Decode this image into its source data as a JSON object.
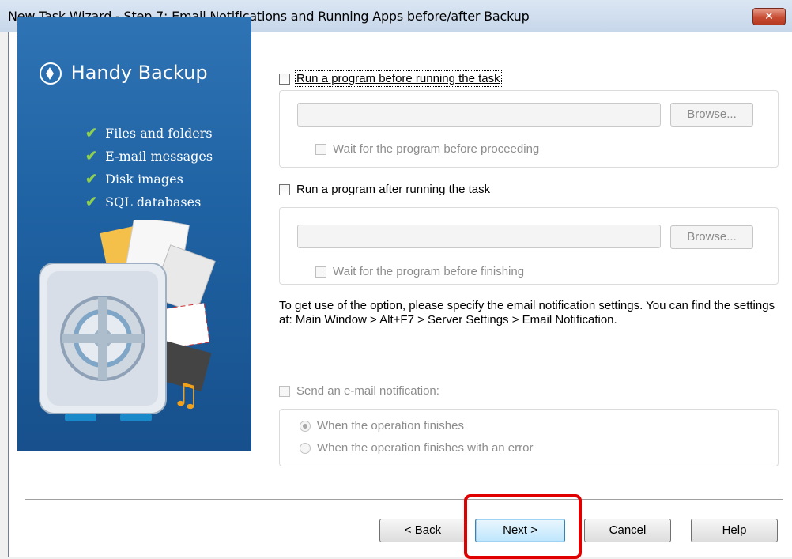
{
  "window": {
    "title": "New Task Wizard - Step 7: Email Notifications and Running Apps before/after Backup",
    "close_label": "✕"
  },
  "banner": {
    "logo_text": "Handy Backup",
    "features": [
      "Files and folders",
      "E-mail messages",
      "Disk images",
      "SQL databases"
    ]
  },
  "run_before": {
    "label": "Run a program before running the task",
    "checked": false,
    "path_value": "",
    "browse_label": "Browse...",
    "wait_label": "Wait for the program before proceeding"
  },
  "run_after": {
    "label": "Run a program after running the task",
    "checked": false,
    "path_value": "",
    "browse_label": "Browse...",
    "wait_label": "Wait for the program before finishing"
  },
  "info_text": "To get use of the option, please specify the email notification settings. You can find the settings at: Main Window > Alt+F7 > Server Settings > Email Notification.",
  "email": {
    "label": "Send an e-mail notification:",
    "options": [
      "When the operation finishes",
      "When the operation finishes with an error"
    ],
    "selected": "When the operation finishes"
  },
  "buttons": {
    "back": "< Back",
    "next": "Next >",
    "cancel": "Cancel",
    "help": "Help"
  },
  "colors": {
    "banner": "#1f62a3",
    "check": "#8fd14f",
    "highlight": "#e00000"
  }
}
